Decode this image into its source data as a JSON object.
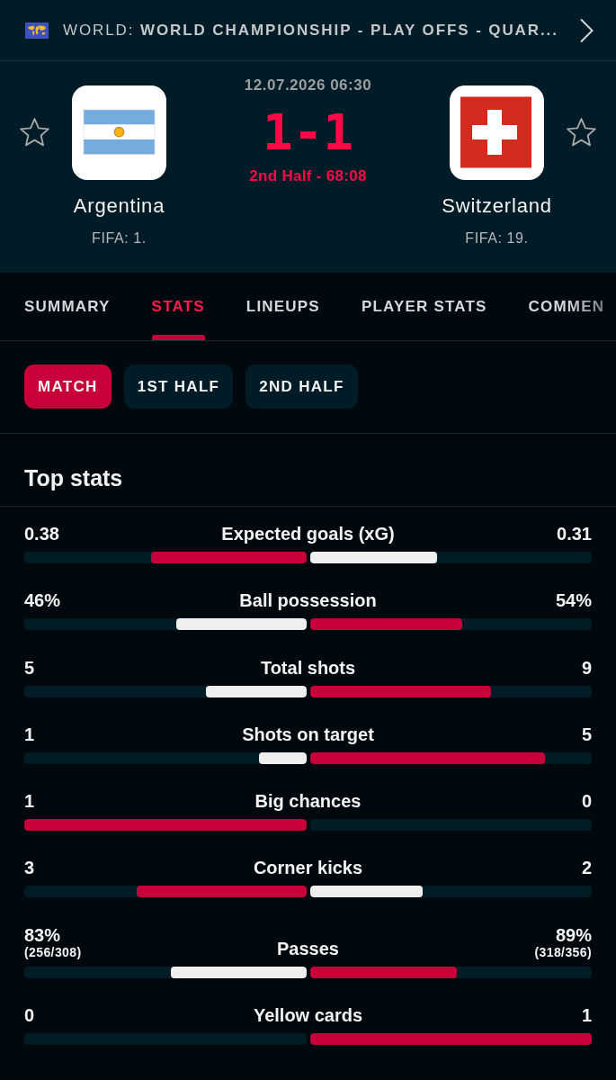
{
  "header": {
    "competition": "WORLD: **WORLD CHAMPIONSHIP - PLAY OFFS - QUAR...**"
  },
  "match": {
    "date": "12.07.2026 06:30",
    "score": "1-1",
    "status": "2nd Half - 68:08"
  },
  "teams": [
    {
      "name": "Argentina",
      "ranking": "FIFA: 1.",
      "favorite": false
    },
    {
      "name": "Switzerland",
      "ranking": "FIFA: 19.",
      "favorite": false
    }
  ],
  "tabs": [
    {
      "label": "SUMMARY",
      "selected": false
    },
    {
      "label": "STATS",
      "selected": true
    },
    {
      "label": "LINEUPS",
      "selected": false
    },
    {
      "label": "PLAYER STATS",
      "selected": false
    },
    {
      "label": "COMMEN",
      "selected": false
    }
  ],
  "periods": [
    {
      "label": "MATCH",
      "selected": true
    },
    {
      "label": "1ST HALF",
      "selected": false
    },
    {
      "label": "2ND HALF",
      "selected": false
    }
  ],
  "top_stats": {
    "title": "Top stats",
    "rows": [
      {
        "label": "Expected goals (xG)",
        "home": {
          "value": "0.38"
        },
        "away": {
          "value": "0.31"
        },
        "level": 0.55
      },
      {
        "label": "Ball possession",
        "home": {
          "value": "46%"
        },
        "away": {
          "value": "54%"
        },
        "level": 0.46
      },
      {
        "label": "Total shots",
        "home": {
          "value": "5"
        },
        "away": {
          "value": "9"
        },
        "level": 0.357
      },
      {
        "label": "Shots on target",
        "home": {
          "value": "1"
        },
        "away": {
          "value": "5"
        },
        "level": 0.167
      },
      {
        "label": "Big chances",
        "home": {
          "value": "1"
        },
        "away": {
          "value": "0"
        },
        "level": 1
      },
      {
        "label": "Corner kicks",
        "home": {
          "value": "3"
        },
        "away": {
          "value": "2"
        },
        "level": 0.6
      },
      {
        "label": "Passes",
        "home": {
          "value": "83%",
          "detail": "(256/308)"
        },
        "away": {
          "value": "89%",
          "detail": "(318/356)"
        },
        "level": 0.48
      },
      {
        "label": "Yellow cards",
        "home": {
          "value": "0"
        },
        "away": {
          "value": "1"
        },
        "level": 0
      }
    ]
  }
}
